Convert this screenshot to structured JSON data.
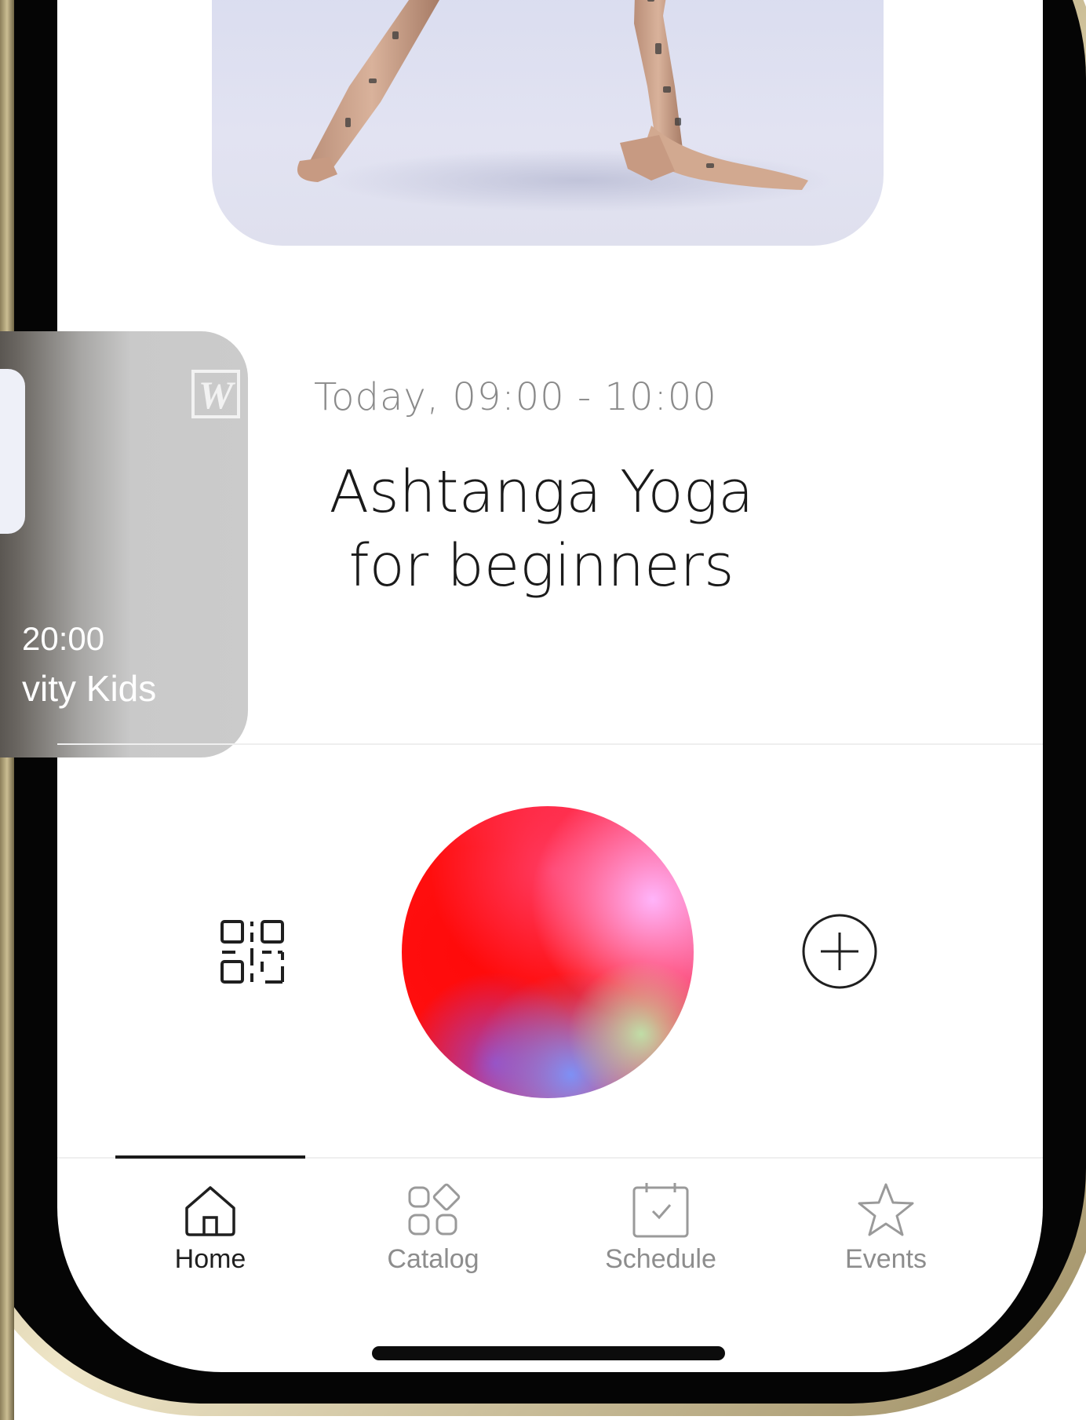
{
  "hero": {
    "image_icon": "yoga-pose-photo"
  },
  "side_card": {
    "time": "20:00",
    "title": "vity Kids",
    "logo_icon": "w-brand-logo"
  },
  "class": {
    "time": "Today, 09:00 - 10:00",
    "title_line1": "Ashtanga Yoga",
    "title_line2": "for beginners"
  },
  "actions": {
    "qr_icon": "qr-code-icon",
    "orb_icon": "gradient-orb",
    "add_icon": "plus-circle-icon"
  },
  "tabs": [
    {
      "label": "Home",
      "icon": "home-icon",
      "active": true
    },
    {
      "label": "Catalog",
      "icon": "catalog-icon",
      "active": false
    },
    {
      "label": "Schedule",
      "icon": "calendar-icon",
      "active": false
    },
    {
      "label": "Events",
      "icon": "star-icon",
      "active": false
    }
  ],
  "colors": {
    "frame_gold": "#b7a77a",
    "text_dark": "#1a1a1a",
    "text_muted": "#8a8a8a",
    "orb_red": "#ff0a0a"
  }
}
